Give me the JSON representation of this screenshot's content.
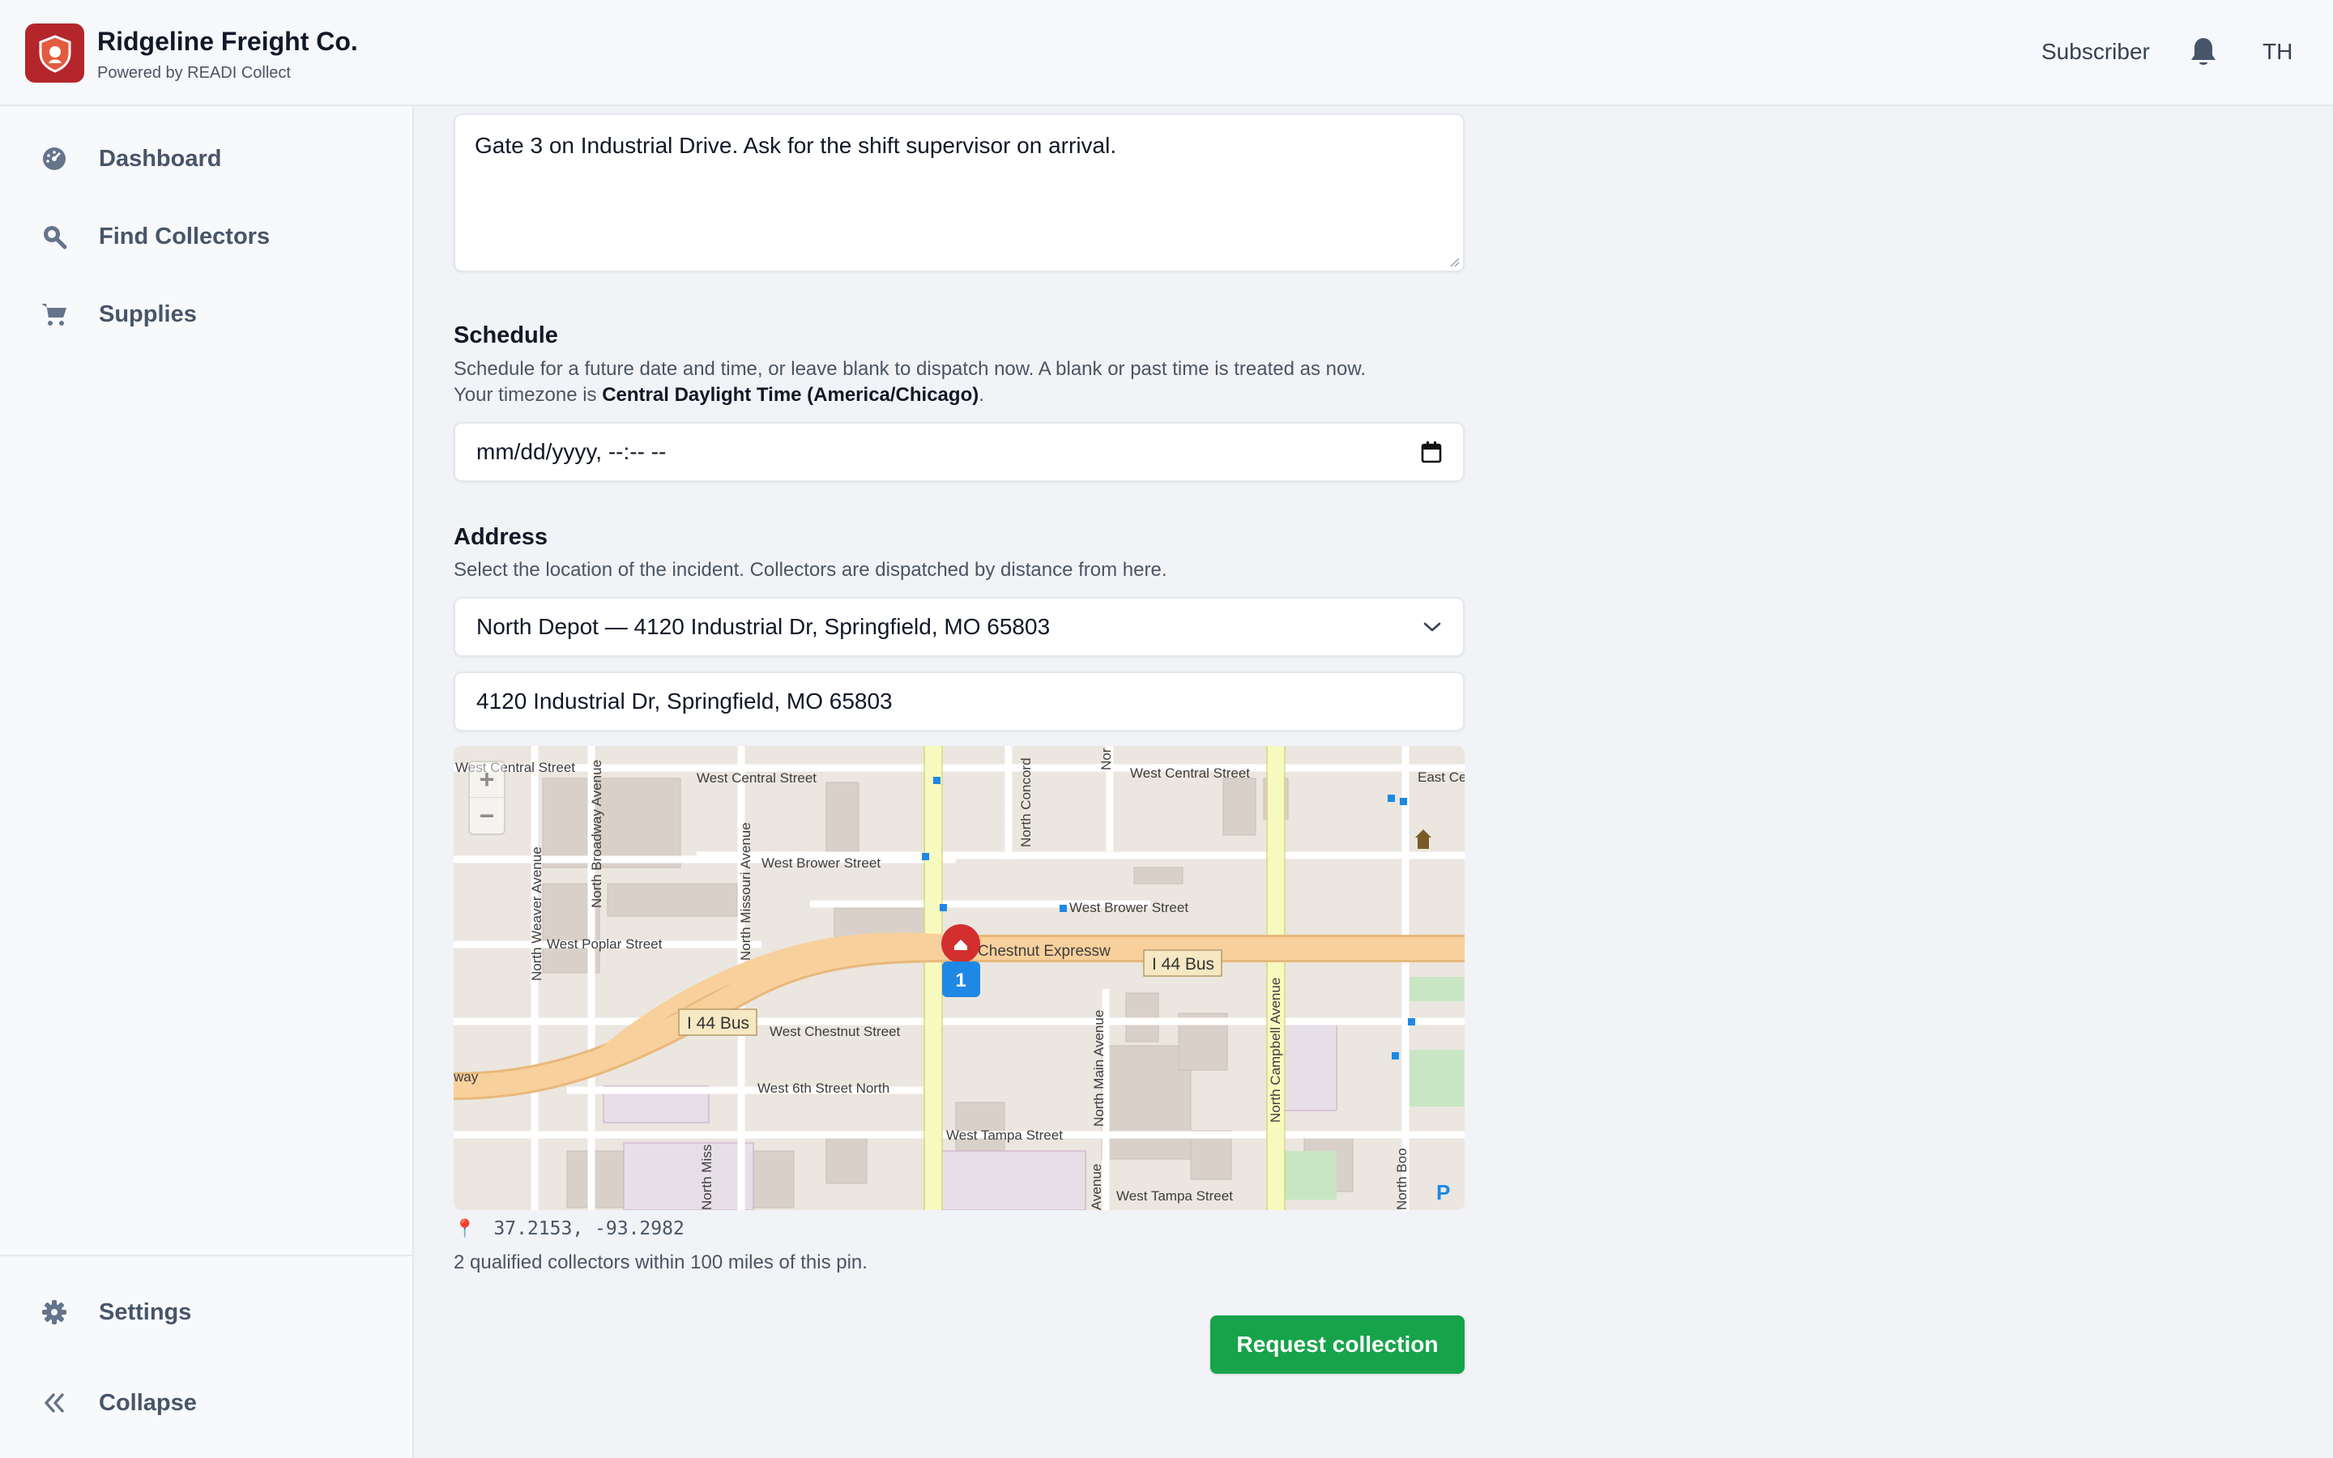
{
  "header": {
    "app_title": "Ridgeline Freight Co.",
    "app_subtitle": "Powered by READI Collect",
    "role": "Subscriber",
    "user_initials": "TH",
    "brand_color": "#b4262b"
  },
  "sidebar": {
    "items": [
      {
        "label": "Dashboard",
        "icon": "dashboard-icon"
      },
      {
        "label": "Find Collectors",
        "icon": "search-icon"
      },
      {
        "label": "Supplies",
        "icon": "cart-icon"
      }
    ],
    "bottom": [
      {
        "label": "Settings",
        "icon": "gear-icon"
      },
      {
        "label": "Collapse",
        "icon": "double-chevron-left-icon"
      }
    ]
  },
  "form": {
    "notes_value": "Gate 3 on Industrial Drive. Ask for the shift supervisor on arrival.",
    "schedule": {
      "title": "Schedule",
      "help_line1": "Schedule for a future date and time, or leave blank to dispatch now. A blank or past time is treated as now.",
      "help_line2_prefix": "Your timezone is ",
      "timezone": "Central Daylight Time (America/Chicago)",
      "help_line2_suffix": ".",
      "datetime_placeholder": "mm/dd/yyyy, --:-- --"
    },
    "address": {
      "title": "Address",
      "help": "Select the location of the incident. Collectors are dispatched by distance from here.",
      "selected_location": "North Depot — 4120 Industrial Dr, Springfield, MO 65803",
      "address_value": "4120 Industrial Dr, Springfield, MO 65803"
    },
    "map": {
      "zoom_in": "+",
      "zoom_out": "−",
      "marker_count": "1",
      "streets": [
        "West Central Street",
        "West Central Street",
        "West Central Street",
        "East Ce",
        "West Brower Street",
        "West Brower Street",
        "West Poplar Street",
        "West Chestnut Street",
        "West 6th Street North",
        "West Tampa Street",
        "West Tampa Street",
        "st Chestnut Expressw",
        "I 44 Bus",
        "I 44 Bus",
        "way",
        "North Weaver Avenue",
        "North Broadway Avenue",
        "North Missouri Avenue",
        "North Concord",
        "Nor",
        "North Main Avenue",
        "North Campbell Avenue",
        "North Boo",
        "North Miss",
        "Avenue",
        "P"
      ]
    },
    "coordinates": "37.2153, -93.2982",
    "collectors_note": "2 qualified collectors within 100 miles of this pin.",
    "submit_label": "Request collection",
    "submit_color": "#16a34a"
  }
}
